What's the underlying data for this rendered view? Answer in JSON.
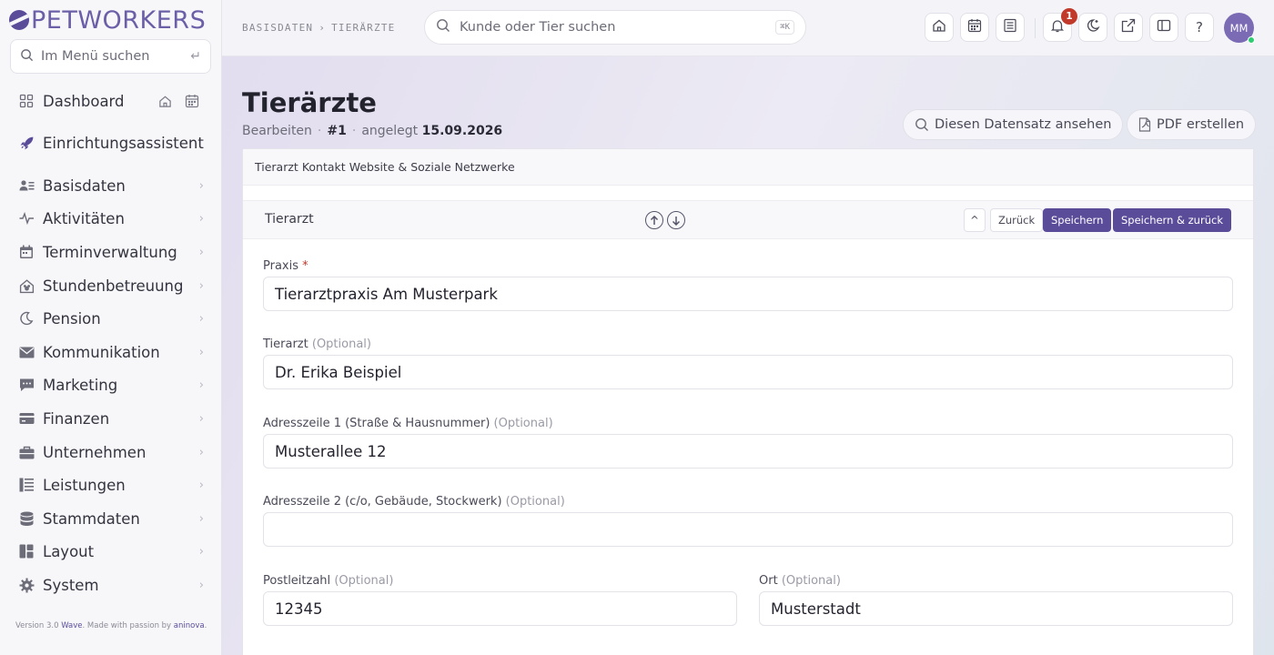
{
  "app": {
    "logo_text": "PETWORKERS"
  },
  "sidebar": {
    "search_placeholder": "Im Menü suchen",
    "items": [
      {
        "label": "Dashboard",
        "icon": "grid-icon"
      },
      {
        "label": "Einrichtungsassistent",
        "icon": "rocket-icon"
      },
      {
        "label": "Basisdaten",
        "icon": "user-list-icon"
      },
      {
        "label": "Aktivitäten",
        "icon": "pulse-icon"
      },
      {
        "label": "Terminverwaltung",
        "icon": "calendar-icon"
      },
      {
        "label": "Stundenbetreuung",
        "icon": "house-paw-icon"
      },
      {
        "label": "Pension",
        "icon": "moon-icon"
      },
      {
        "label": "Kommunikation",
        "icon": "envelope-icon"
      },
      {
        "label": "Marketing",
        "icon": "chat-icon"
      },
      {
        "label": "Finanzen",
        "icon": "wallet-icon"
      },
      {
        "label": "Unternehmen",
        "icon": "briefcase-icon"
      },
      {
        "label": "Leistungen",
        "icon": "list-icon"
      },
      {
        "label": "Stammdaten",
        "icon": "database-icon"
      },
      {
        "label": "Layout",
        "icon": "layout-icon"
      },
      {
        "label": "System",
        "icon": "gear-icon"
      }
    ],
    "footer": {
      "prefix": "Version 3.0 ",
      "wave": "Wave",
      "middle": ". Made with passion by ",
      "brand": "aninova",
      "suffix": "."
    }
  },
  "topbar": {
    "breadcrumb": [
      "BASISDATEN",
      "TIERÄRZTE"
    ],
    "breadcrumb_sep": "›",
    "search_placeholder": "Kunde oder Tier suchen",
    "search_shortcut": "⌘K",
    "notification_count": "1",
    "help_label": "?",
    "avatar_initials": "MM"
  },
  "page": {
    "title": "Tierärzte",
    "subtitle_mode": "Bearbeiten",
    "record_id": "#1",
    "created_label": "angelegt",
    "created_date": "15.09.2026",
    "view_button": "Diesen Datensatz ansehen",
    "pdf_button": "PDF erstellen"
  },
  "card": {
    "tabs": [
      "Tierarzt",
      "Kontakt",
      "Website & Soziale Netzwerke"
    ],
    "section_title": "Tierarzt",
    "collapse_label": "^",
    "back_button": "Zurück",
    "save_button": "Speichern",
    "save_back_button": "Speichern & zurück"
  },
  "form": {
    "optional_suffix": "(Optional)",
    "required_mark": "*",
    "praxis": {
      "label": "Praxis",
      "value": "Tierarztpraxis Am Musterpark"
    },
    "tierarzt": {
      "label": "Tierarzt",
      "value": "Dr. Erika Beispiel"
    },
    "address1": {
      "label": "Adresszeile 1 (Straße & Hausnummer)",
      "value": "Musterallee 12"
    },
    "address2": {
      "label": "Adresszeile 2 (c/o, Gebäude, Stockwerk)",
      "value": ""
    },
    "zip": {
      "label": "Postleitzahl",
      "value": "12345"
    },
    "city": {
      "label": "Ort",
      "value": "Musterstadt"
    }
  }
}
